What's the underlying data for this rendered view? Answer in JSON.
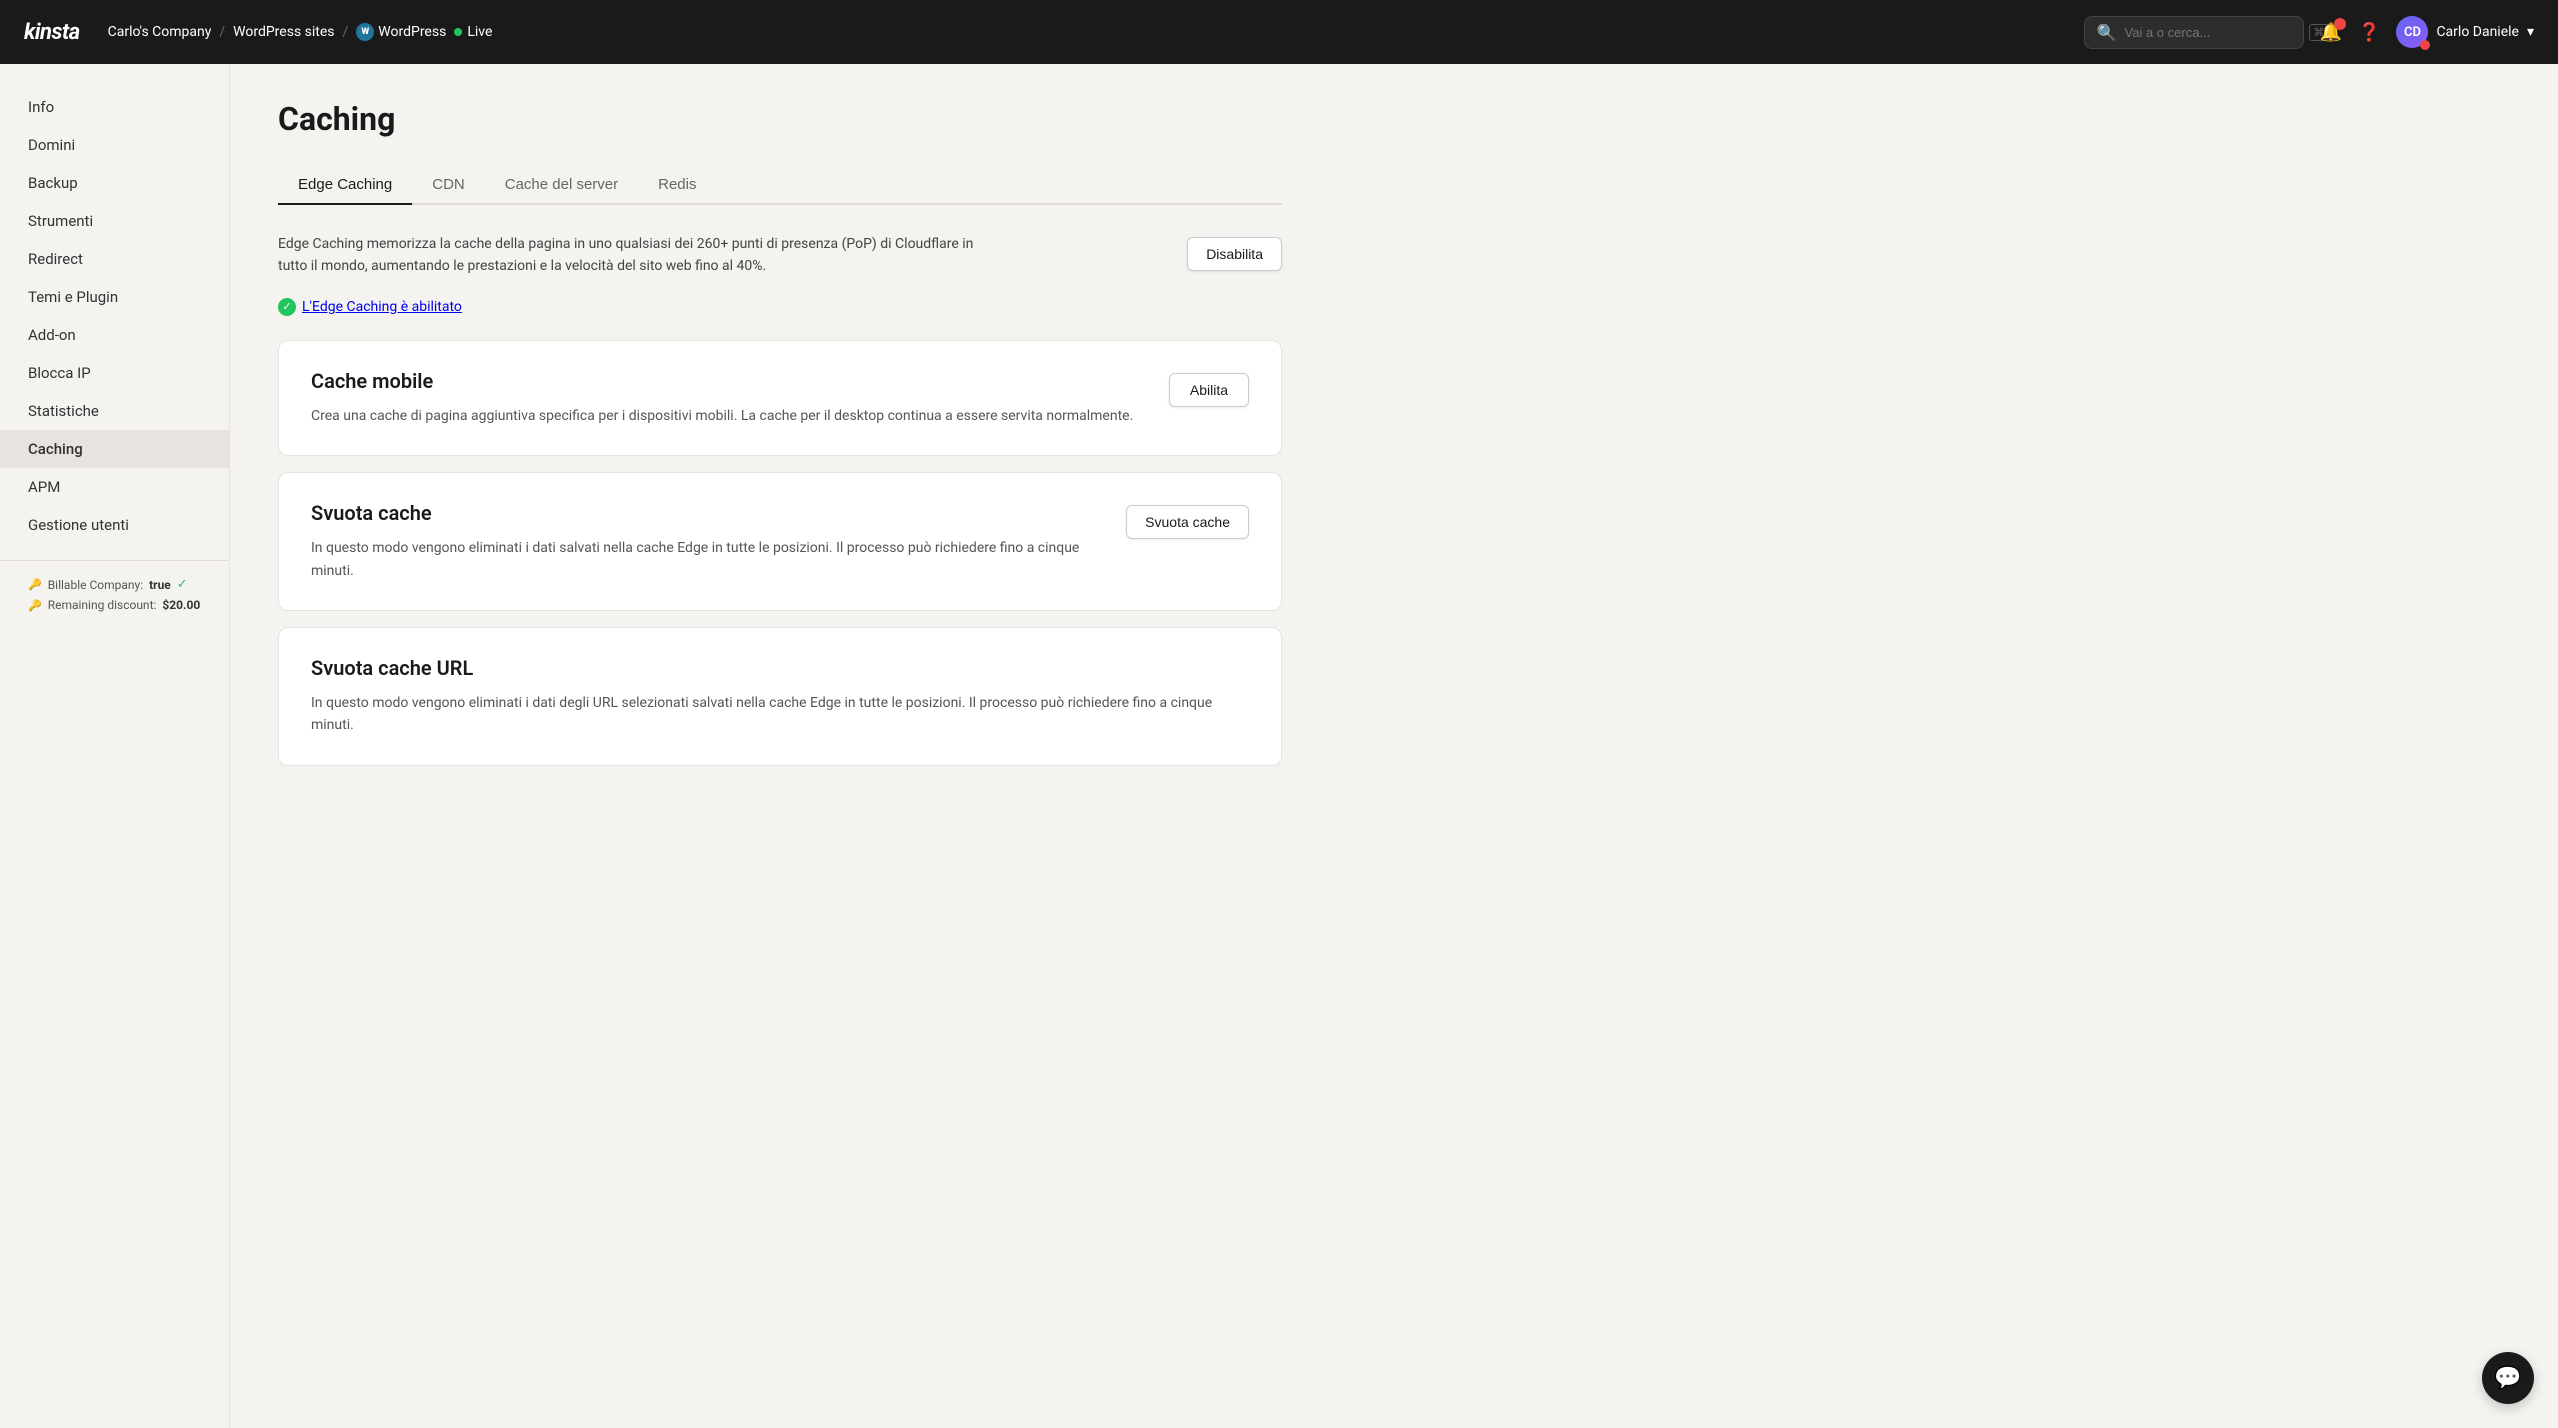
{
  "topnav": {
    "logo": "kinsta",
    "breadcrumb": {
      "company": "Carlo's Company",
      "sep1": "/",
      "wordpress_sites": "WordPress sites",
      "sep2": "/",
      "site": "WordPress"
    },
    "live_label": "Live",
    "search_placeholder": "Vai a o cerca...",
    "search_kbd": "⌘/",
    "user_name": "Carlo Daniele"
  },
  "sidebar": {
    "items": [
      {
        "label": "Info",
        "id": "info"
      },
      {
        "label": "Domini",
        "id": "domini"
      },
      {
        "label": "Backup",
        "id": "backup"
      },
      {
        "label": "Strumenti",
        "id": "strumenti"
      },
      {
        "label": "Redirect",
        "id": "redirect"
      },
      {
        "label": "Temi e Plugin",
        "id": "temi-plugin"
      },
      {
        "label": "Add-on",
        "id": "addon"
      },
      {
        "label": "Blocca IP",
        "id": "blocca-ip"
      },
      {
        "label": "Statistiche",
        "id": "statistiche"
      },
      {
        "label": "Caching",
        "id": "caching",
        "active": true
      },
      {
        "label": "APM",
        "id": "apm"
      },
      {
        "label": "Gestione utenti",
        "id": "gestione-utenti"
      }
    ],
    "footer": {
      "billable_label": "Billable Company:",
      "billable_value": "true",
      "discount_label": "Remaining discount:",
      "discount_value": "$20.00"
    }
  },
  "main": {
    "page_title": "Caching",
    "tabs": [
      {
        "label": "Edge Caching",
        "active": true
      },
      {
        "label": "CDN"
      },
      {
        "label": "Cache del server"
      },
      {
        "label": "Redis"
      }
    ],
    "description": "Edge Caching memorizza la cache della pagina in uno qualsiasi dei 260+ punti di presenza (PoP) di Cloudflare in tutto il mondo, aumentando le prestazioni e la velocità del sito web fino al 40%.",
    "btn_disabilita": "Disabilita",
    "status_label": "L'Edge Caching è abilitato",
    "cards": [
      {
        "id": "cache-mobile",
        "title": "Cache mobile",
        "desc": "Crea una cache di pagina aggiuntiva specifica per i dispositivi mobili.\nLa cache per il desktop continua a essere servita normalmente.",
        "btn": "Abilita"
      },
      {
        "id": "svuota-cache",
        "title": "Svuota cache",
        "desc": "In questo modo vengono eliminati i dati salvati nella cache Edge in tutte le posizioni. Il processo può richiedere fino a cinque minuti.",
        "btn": "Svuota cache"
      },
      {
        "id": "svuota-cache-url",
        "title": "Svuota cache URL",
        "desc": "In questo modo vengono eliminati i dati degli URL selezionati salvati nella cache Edge in tutte le posizioni. Il processo può richiedere fino a cinque minuti.",
        "btn": null
      }
    ]
  }
}
